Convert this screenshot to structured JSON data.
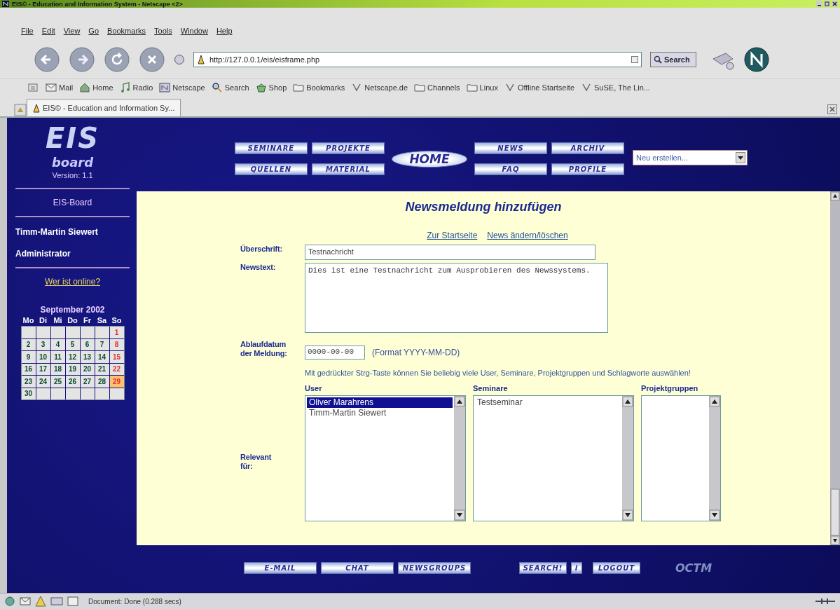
{
  "window": {
    "title": "EIS© - Education and Information System - Netscape <2>"
  },
  "menu": [
    "File",
    "Edit",
    "View",
    "Go",
    "Bookmarks",
    "Tools",
    "Window",
    "Help"
  ],
  "address": {
    "value": "http://127.0.0.1/eis/eisframe.php"
  },
  "search_button": "Search",
  "personal_toolbar": [
    {
      "label": "Mail",
      "kind": "mail"
    },
    {
      "label": "Home",
      "kind": "home"
    },
    {
      "label": "Radio",
      "kind": "radio"
    },
    {
      "label": "Netscape",
      "kind": "netscape"
    },
    {
      "label": "Search",
      "kind": "search"
    },
    {
      "label": "Shop",
      "kind": "shop"
    },
    {
      "label": "Bookmarks",
      "kind": "folder"
    },
    {
      "label": "Netscape.de",
      "kind": "link"
    },
    {
      "label": "Channels",
      "kind": "folder"
    },
    {
      "label": "Linux",
      "kind": "folder"
    },
    {
      "label": "Offline Startseite",
      "kind": "link"
    },
    {
      "label": "SuSE, The Lin...",
      "kind": "link"
    }
  ],
  "tabs": [
    {
      "label": "EIS© - Education and Information Sy...",
      "selected": true
    }
  ],
  "sidebar": {
    "logo": "EIS",
    "logo_sub": "board",
    "version": "Version: 1.1",
    "board_link": "EIS-Board",
    "user_name": "Timm-Martin Siewert",
    "role": "Administrator",
    "online_link": "Wer ist online?",
    "calendar": {
      "title": "September 2002",
      "weekdays": [
        "Mo",
        "Di",
        "Mi",
        "Do",
        "Fr",
        "Sa",
        "So"
      ],
      "days": [
        {
          "kind": "blank"
        },
        {
          "kind": "blank"
        },
        {
          "kind": "blank"
        },
        {
          "kind": "blank"
        },
        {
          "kind": "blank"
        },
        {
          "kind": "blank"
        },
        {
          "day": "1",
          "kind": "sunday"
        },
        {
          "day": "2",
          "kind": "weekday"
        },
        {
          "day": "3",
          "kind": "weekday"
        },
        {
          "day": "4",
          "kind": "weekday"
        },
        {
          "day": "5",
          "kind": "weekday"
        },
        {
          "day": "6",
          "kind": "weekday"
        },
        {
          "day": "7",
          "kind": "weekday"
        },
        {
          "day": "8",
          "kind": "sunday"
        },
        {
          "day": "9",
          "kind": "weekday"
        },
        {
          "day": "10",
          "kind": "weekday"
        },
        {
          "day": "11",
          "kind": "weekday"
        },
        {
          "day": "12",
          "kind": "weekday"
        },
        {
          "day": "13",
          "kind": "weekday"
        },
        {
          "day": "14",
          "kind": "weekday"
        },
        {
          "day": "15",
          "kind": "sunday"
        },
        {
          "day": "16",
          "kind": "weekday"
        },
        {
          "day": "17",
          "kind": "weekday"
        },
        {
          "day": "18",
          "kind": "weekday"
        },
        {
          "day": "19",
          "kind": "weekday"
        },
        {
          "day": "20",
          "kind": "weekday"
        },
        {
          "day": "21",
          "kind": "weekday"
        },
        {
          "day": "22",
          "kind": "sunday"
        },
        {
          "day": "23",
          "kind": "weekday"
        },
        {
          "day": "24",
          "kind": "weekday"
        },
        {
          "day": "25",
          "kind": "weekday"
        },
        {
          "day": "26",
          "kind": "weekday"
        },
        {
          "day": "27",
          "kind": "weekday"
        },
        {
          "day": "28",
          "kind": "weekday"
        },
        {
          "day": "29",
          "kind": "today"
        },
        {
          "day": "30",
          "kind": "weekday"
        },
        {
          "kind": "blank"
        },
        {
          "kind": "blank"
        },
        {
          "kind": "blank"
        },
        {
          "kind": "blank"
        },
        {
          "kind": "blank"
        },
        {
          "kind": "blank"
        }
      ]
    }
  },
  "nav": {
    "left": [
      "SEMINARE",
      "PROJEKTE",
      "QUELLEN",
      "MATERIAL"
    ],
    "home": "HOME",
    "right": [
      "NEWS",
      "ARCHIV",
      "FAQ",
      "PROFILE"
    ],
    "dropdown": "Neu erstellen..."
  },
  "form": {
    "title": "Newsmeldung hinzufügen",
    "links": [
      "Zur Startseite",
      "News ändern/löschen"
    ],
    "headline_label": "Überschrift:",
    "headline_value": "Testnachricht",
    "text_label": "Newstext:",
    "text_value": "Dies ist eine Testnachricht zum Ausprobieren des Newssystems.",
    "date_label": "Ablaufdatum der Meldung:",
    "date_value": "0000-00-00",
    "date_hint": "(Format YYYY-MM-DD)",
    "note": "Mit gedrückter Strg-Taste können Sie beliebig viele User, Seminare, Projektgruppen und Schlagworte auswählen!",
    "relevant_label": "Relevant für:",
    "lists": [
      {
        "heading": "User",
        "options": [
          {
            "label": "Oliver Marahrens",
            "selected": true
          },
          {
            "label": "Timm-Martin Siewert",
            "selected": false
          }
        ]
      },
      {
        "heading": "Seminare",
        "options": [
          {
            "label": "Testseminar",
            "selected": false
          }
        ]
      },
      {
        "heading": "Projektgruppen"
      }
    ]
  },
  "footer": {
    "buttons": [
      "E-MAIL",
      "CHAT",
      "NEWSGROUPS"
    ],
    "buttons_right": [
      "SEARCH!",
      "i",
      "LOGOUT"
    ],
    "logo": "OCTM"
  },
  "status_bar": {
    "text": "Document: Done (0.288 secs)"
  }
}
